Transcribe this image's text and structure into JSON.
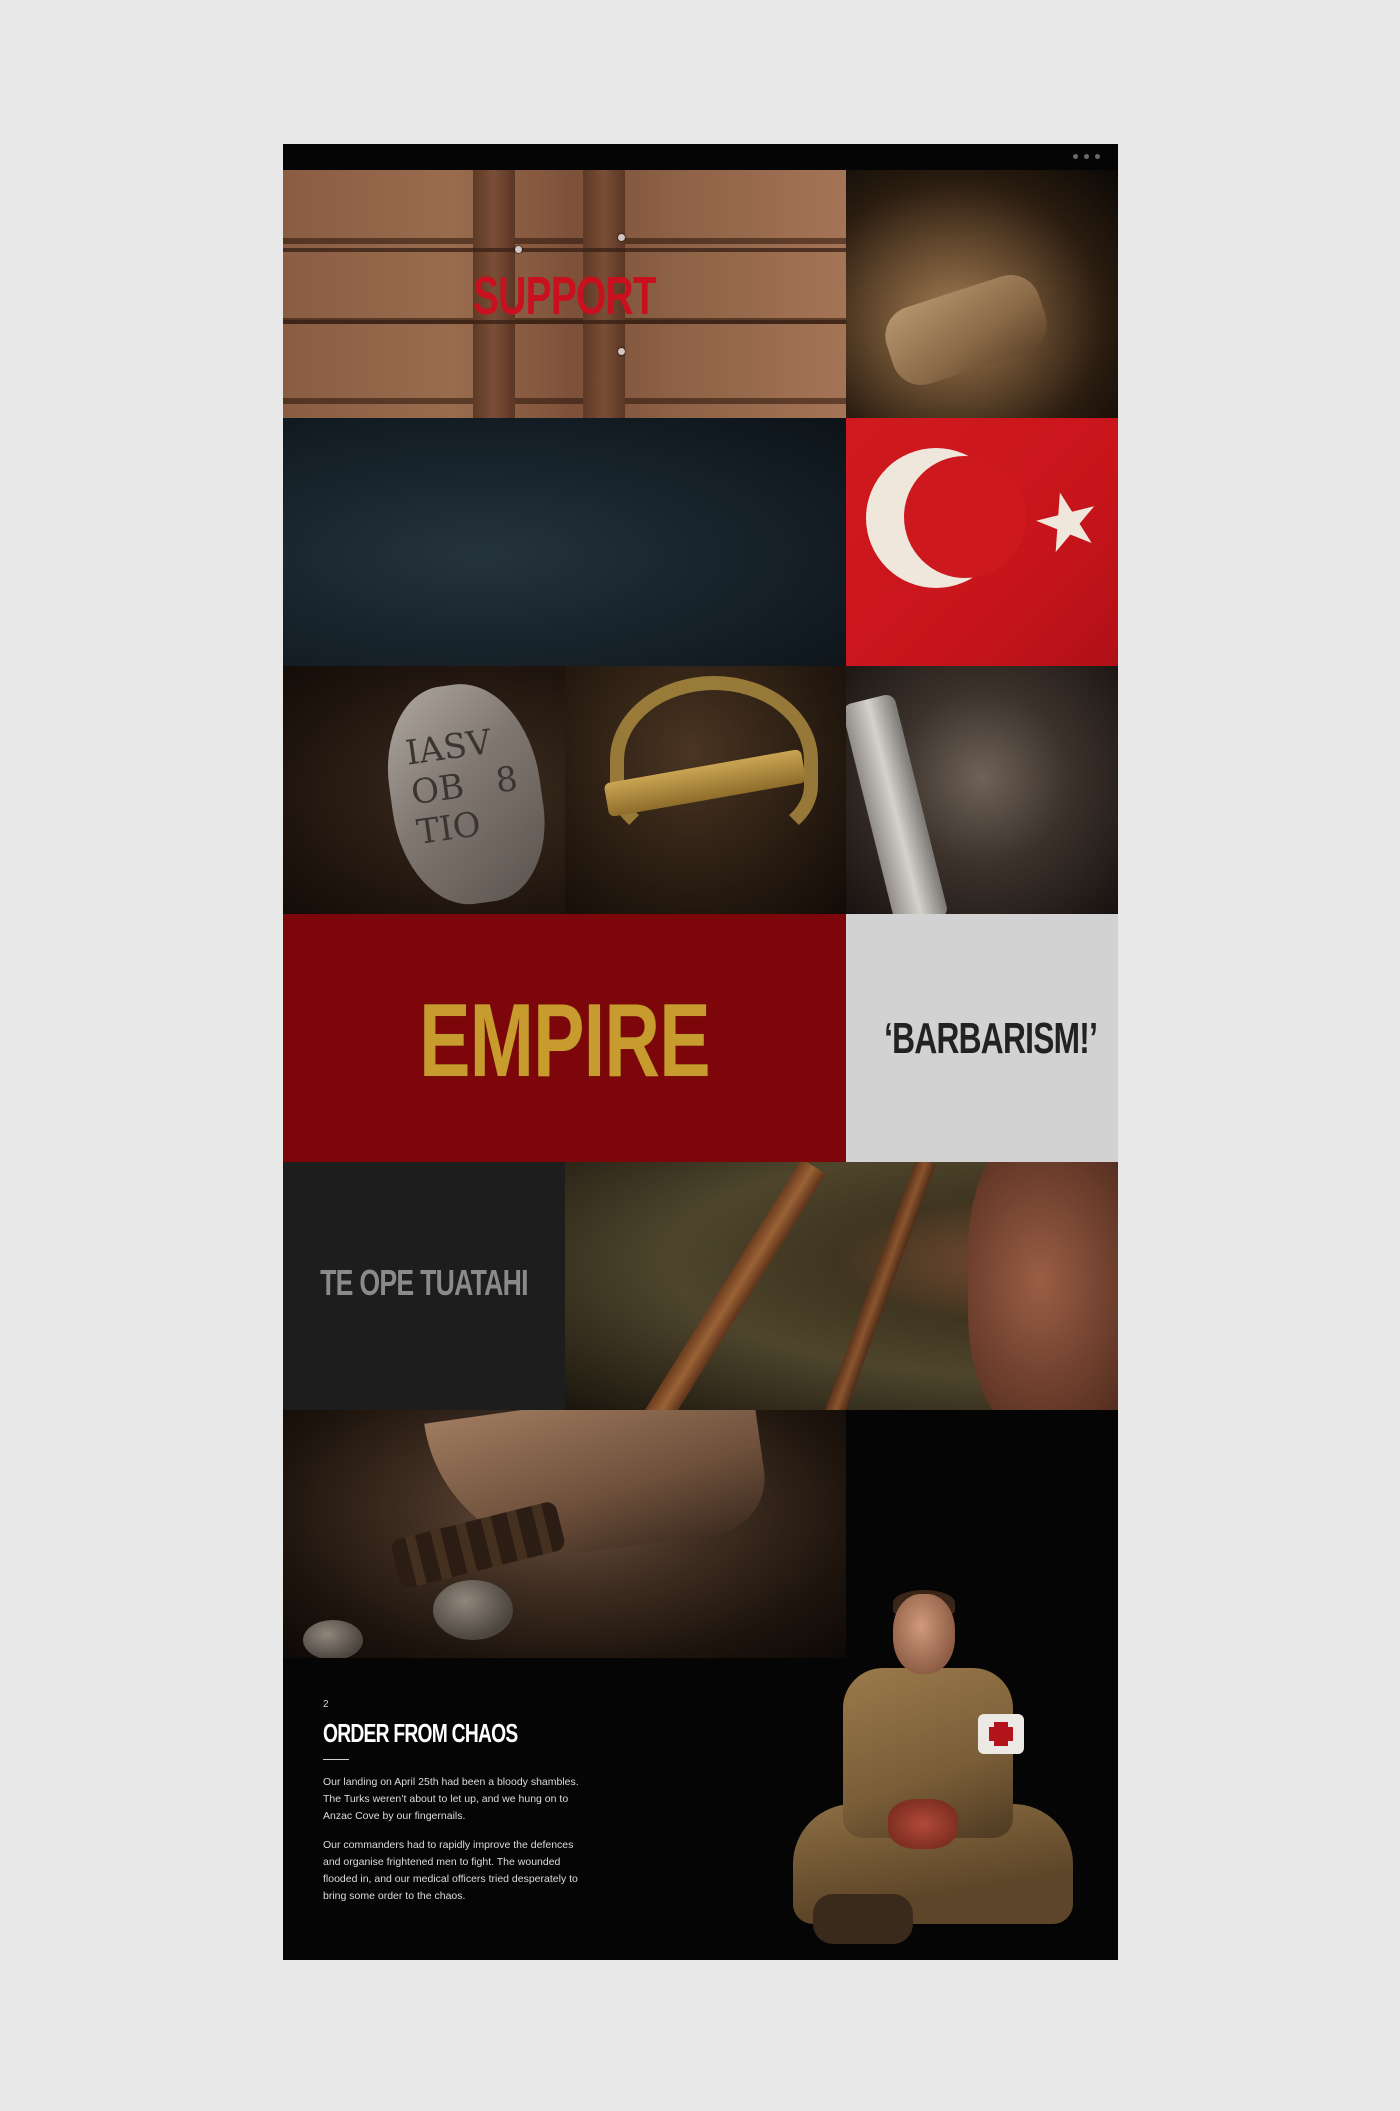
{
  "tiles": {
    "support": "SUPPORT",
    "empire": "EMPIRE",
    "barbarism": "‘BARBARISM!’",
    "te_ope": "TE OPE TUATAHI",
    "tag_inscription": "IASV\nOB   8\nTIO"
  },
  "chapter": {
    "number": "2",
    "title": "ORDER FROM CHAOS",
    "paragraphs": [
      "Our landing on April 25th had been a bloody shambles. The Turks weren’t about to let up, and we hung on to Anzac Cove by our fingernails.",
      "Our commanders had to rapidly improve the defences and organise frightened men to fight. The wounded flooded in, and our medical officers tried desperately to bring some order to the chaos."
    ]
  },
  "colors": {
    "support_red": "#c8101e",
    "empire_bg": "#7c0609",
    "empire_gold": "#c79b2d",
    "barbarism_bg": "#d2d2d2",
    "page_bg": "#e8e8e8"
  },
  "icons": {
    "window_menu": "three-dots-icon"
  }
}
